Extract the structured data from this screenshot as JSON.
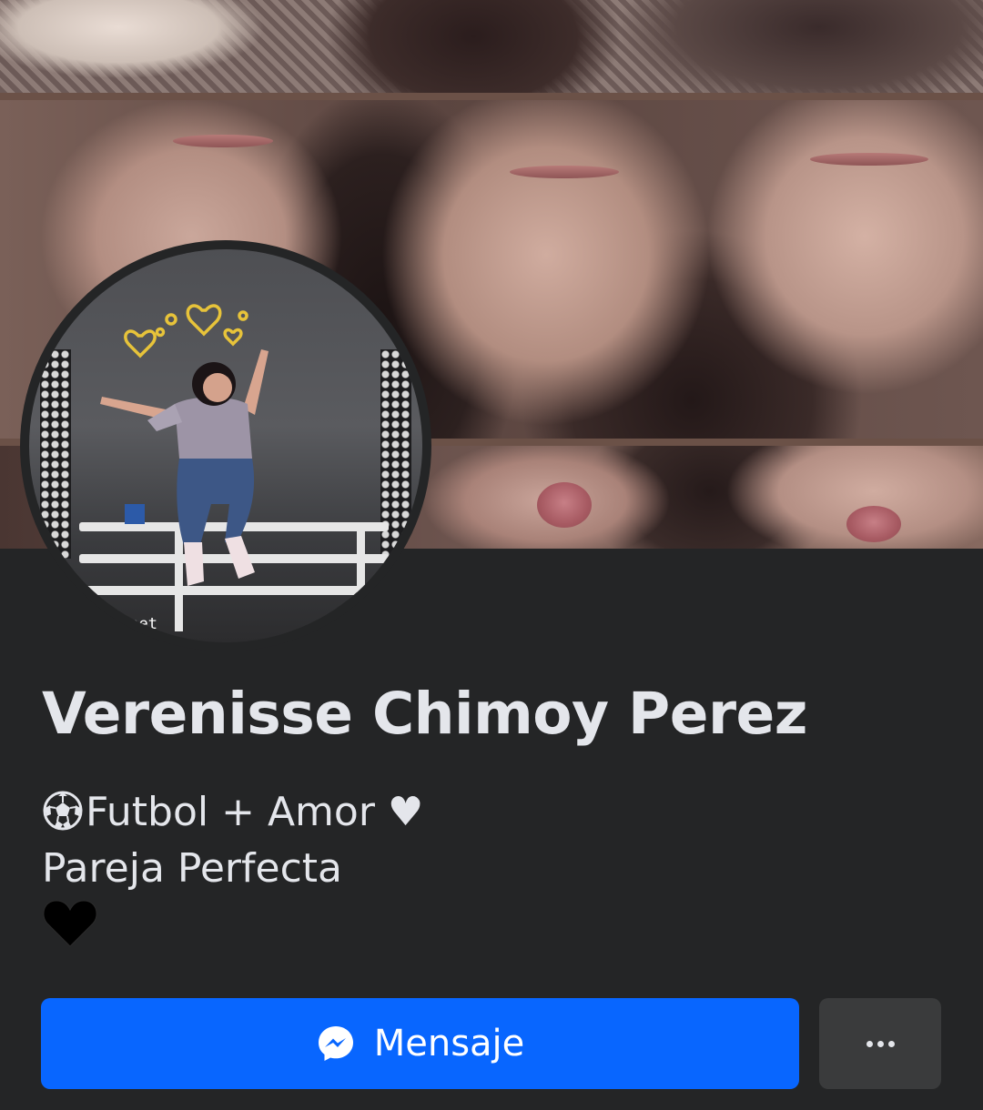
{
  "profile": {
    "name": "Verenisse Chimoy Perez",
    "bio_line_1": "Futbol + Amor ♥",
    "bio_line_2": "Pareja Perfecta",
    "bio_line_3": "🖤",
    "avatar_overlay_text": "weet"
  },
  "actions": {
    "message_label": "Mensaje",
    "more_label": "···"
  },
  "icons": {
    "message": "messenger-icon",
    "more": "more-options-icon",
    "bio_prefix": "soccer-ball-icon"
  },
  "colors": {
    "background": "#242526",
    "text_primary": "#e4e6eb",
    "primary_button": "#0866ff",
    "secondary_button": "#3a3b3c"
  }
}
